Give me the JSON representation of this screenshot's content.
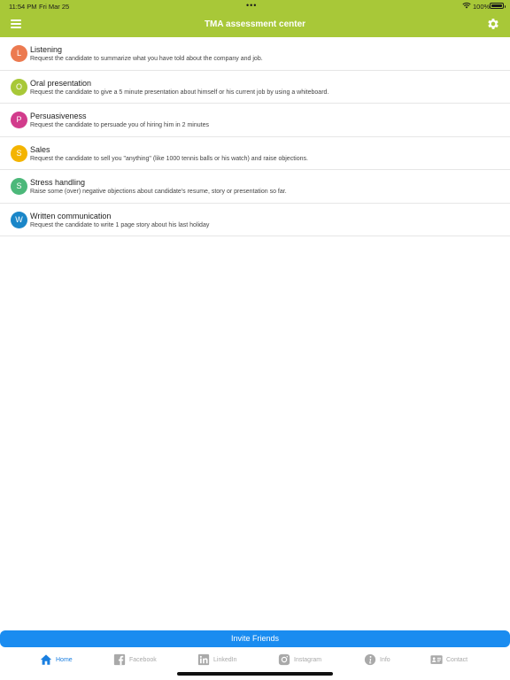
{
  "status_bar": {
    "time": "11:54 PM",
    "date": "Fri Mar 25",
    "dots": "•••",
    "battery_pct": "100%"
  },
  "header": {
    "title": "TMA assessment center",
    "background": "#a8c838"
  },
  "items": [
    {
      "initial": "L",
      "title": "Listening",
      "desc": "Request the candidate to summarize what you have told about the company and job.",
      "color": "#ec7a50"
    },
    {
      "initial": "O",
      "title": "Oral presentation",
      "desc": "Request the candidate to give a 5 minute presentation about himself or his current job by using a whiteboard.",
      "color": "#a8c838"
    },
    {
      "initial": "P",
      "title": "Persuasiveness",
      "desc": "Request the candidate to persuade you of hiring him in 2 minutes",
      "color": "#d23c8c"
    },
    {
      "initial": "S",
      "title": "Sales",
      "desc": "Request the candidate to sell you \"anything\" (like 1000 tennis balls or his watch) and raise objections.",
      "color": "#f4b400"
    },
    {
      "initial": "S",
      "title": "Stress handling",
      "desc": "Raise some (over) negative objections about candidate's resume, story or presentation so far.",
      "color": "#4cb87a"
    },
    {
      "initial": "W",
      "title": "Written communication",
      "desc": "Request the candidate to write 1 page story about his last holiday",
      "color": "#1a86c8"
    }
  ],
  "invite_label": "Invite Friends",
  "tabs": [
    {
      "label": "Home",
      "icon": "home-icon",
      "active": true
    },
    {
      "label": "Facebook",
      "icon": "facebook-icon"
    },
    {
      "label": "LinkedIn",
      "icon": "linkedin-icon"
    },
    {
      "label": "Instagram",
      "icon": "instagram-icon"
    },
    {
      "label": "Info",
      "icon": "info-icon"
    },
    {
      "label": "Contact",
      "icon": "contact-card-icon"
    }
  ],
  "colors": {
    "accent": "#1a8cf0",
    "tab_active": "#1a7fe0",
    "tab_inactive": "#a9a9a9"
  }
}
